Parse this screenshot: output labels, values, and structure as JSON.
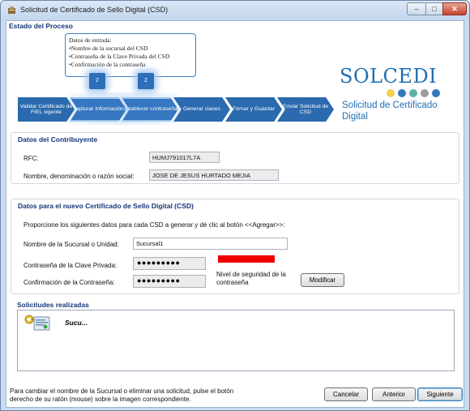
{
  "window": {
    "title": "Solicitud de Certificado de Sello Digital (CSD)",
    "minimize_icon": "minimize-icon",
    "maximize_icon": "maximize-icon",
    "close_icon": "close-icon"
  },
  "process": {
    "title": "Estado del Proceso",
    "input_box": {
      "heading": "Datos de entrada:",
      "items": [
        "•Nombre de la sucursal del CSD",
        "•Contraseña de la Clave Privada del CSD",
        "•Confirmación de la contraseña"
      ]
    },
    "badges": [
      "2",
      "2"
    ],
    "steps": [
      "Validar Certificado de FIEL vigente",
      "Capturar Información",
      "Establecer contraseña",
      "Generar claves",
      "Firmar y Guardar",
      "Enviar Solicitud de CSD"
    ]
  },
  "logo": {
    "name": "SOLCEDI",
    "subtitle_line1": "Solicitud de Certificado",
    "subtitle_line2": "Digital",
    "colors": {
      "brand": "#1f6fb4",
      "dot_yellow": "#f2d04f",
      "dot_blue": "#2f78bd",
      "dot_teal": "#5cb0a8",
      "dot_gray": "#9c9c9c"
    }
  },
  "contribuyente": {
    "title": "Datos del Contribuyente",
    "rfc_label": "RFC:",
    "rfc_value": "HUMJ791017L7A",
    "nombre_label": "Nombre, denominación o razón social:",
    "nombre_value": "JOSE DE JESUS HURTADO MEJIA"
  },
  "csd": {
    "title": "Datos para el nuevo Certificado de Sello Digital (CSD)",
    "instruction": "Proporcione los siguientes datos para cada CSD a generar y dé clic al botón <<Agregar>>:",
    "sucursal_label": "Nombre de la Sucursal o Unidad:",
    "sucursal_value": "Sucursal1",
    "password_label": "Contraseña de la Clave Privada:",
    "password_value": "●●●●●●●●●",
    "confirm_label": "Confirmación de la Contraseña:",
    "confirm_value": "●●●●●●●●●",
    "strength_label": "Nivel de seguridad de la contraseña",
    "modify_button": "Modificar",
    "strength_color": "#ee0000"
  },
  "solicitudes": {
    "title": "Solicitudes realizadas",
    "items": [
      {
        "label": "Sucu...",
        "icon": "certificate-key-icon"
      }
    ]
  },
  "footer": {
    "hint": "Para cambiar el nombre de la Sucursal o eliminar una solicitud, pulse el botón derecho de su ratón (mouse) sobre la imagen correspondiente.",
    "cancel_button": "Cancelar",
    "back_button": "Anterior",
    "next_button": "Siguiente"
  }
}
